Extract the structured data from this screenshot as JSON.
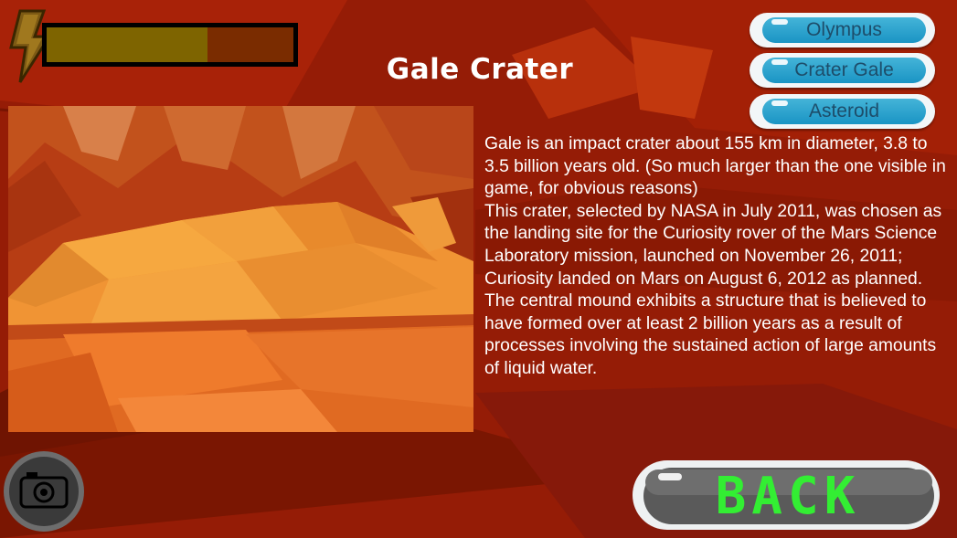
{
  "screen": {
    "title": "Gale Crater",
    "description": [
      "Gale is an impact crater about 155 km in diameter, 3.8 to 3.5 billion years old. (So much larger than the one visible in game, for obvious reasons)",
      "This crater, selected by NASA in July 2011, was chosen as the landing site for the Curiosity rover of the Mars Science Laboratory mission, launched on November 26, 2011; Curiosity landed on Mars on August 6, 2012 as planned.",
      "The central mound exhibits a structure that is believed to have formed over at least 2 billion years as a result of processes involving the sustained action of large amounts of liquid water."
    ]
  },
  "energy": {
    "icon": "lightning-bolt-icon",
    "level_fraction": 0.65
  },
  "location_buttons": [
    "Olympus",
    "Crater Gale",
    "Asteroid"
  ],
  "back_button": {
    "label": "BACK"
  },
  "camera_button": {
    "icon": "camera-icon"
  },
  "colors": {
    "back_text": "#33ee33",
    "location_button": "#2aa4d0",
    "energy_fill": "#7e6400",
    "background": "#9a1e06"
  }
}
